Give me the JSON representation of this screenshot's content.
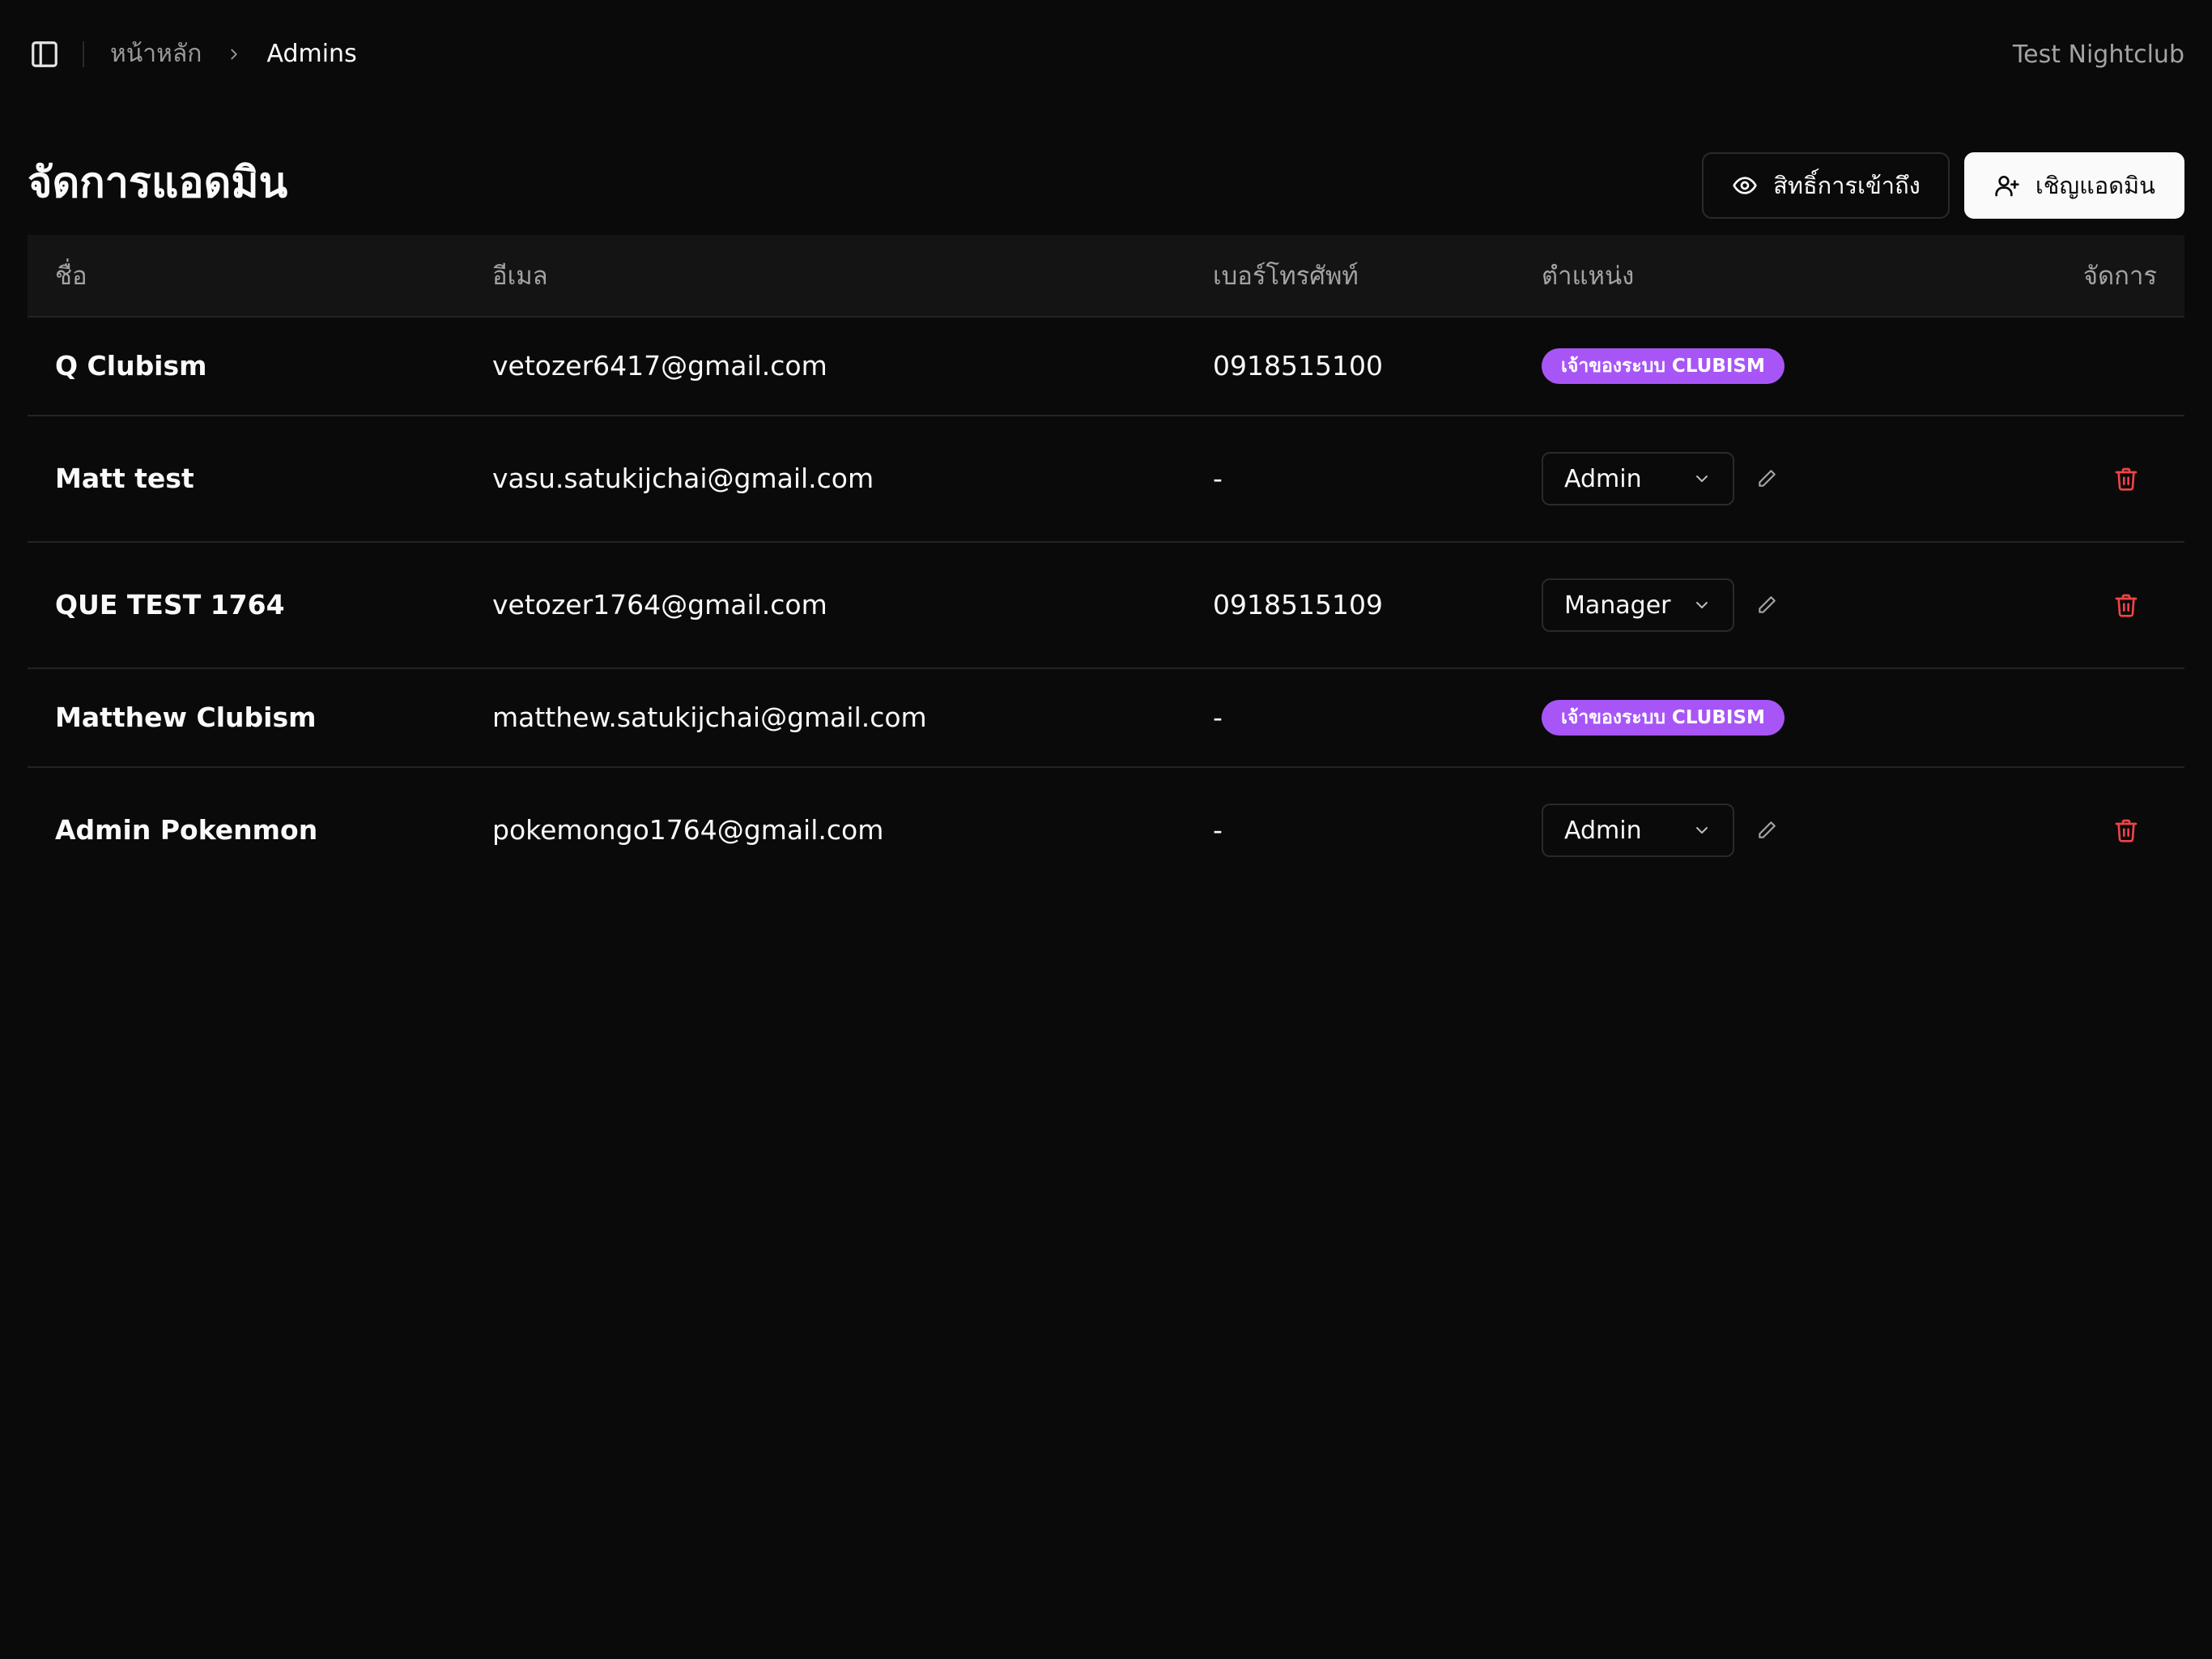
{
  "breadcrumb": {
    "home": "หน้าหลัก",
    "current": "Admins"
  },
  "header": {
    "club_name": "Test Nightclub"
  },
  "page": {
    "title": "จัดการแอดมิน"
  },
  "actions": {
    "permissions_label": "สิทธิ์การเข้าถึง",
    "invite_label": "เชิญแอดมิน"
  },
  "table": {
    "headers": {
      "name": "ชื่อ",
      "email": "อีเมล",
      "phone": "เบอร์โทรศัพท์",
      "role": "ตำแหน่ง",
      "actions": "จัดการ"
    },
    "rows": [
      {
        "name": "Q Clubism",
        "email": "vetozer6417@gmail.com",
        "phone": "0918515100",
        "role": "เจ้าของระบบ CLUBISM",
        "role_type": "badge"
      },
      {
        "name": "Matt test",
        "email": "vasu.satukijchai@gmail.com",
        "phone": "-",
        "role": "Admin",
        "role_type": "select"
      },
      {
        "name": "QUE TEST 1764",
        "email": "vetozer1764@gmail.com",
        "phone": "0918515109",
        "role": "Manager",
        "role_type": "select"
      },
      {
        "name": "Matthew Clubism",
        "email": "matthew.satukijchai@gmail.com",
        "phone": "-",
        "role": "เจ้าของระบบ CLUBISM",
        "role_type": "badge"
      },
      {
        "name": "Admin Pokenmon",
        "email": "pokemongo1764@gmail.com",
        "phone": "-",
        "role": "Admin",
        "role_type": "select"
      }
    ]
  },
  "icons": {
    "sidebar_toggle": "panel-left-icon",
    "breadcrumb_separator": "chevron-right-icon",
    "permissions": "eye-icon",
    "invite": "user-plus-icon",
    "select": "chevron-down-icon",
    "edit": "pencil-icon",
    "delete": "trash-icon"
  },
  "colors": {
    "background": "#0a0a0a",
    "badge": "#a855f7",
    "danger": "#ef4444"
  }
}
